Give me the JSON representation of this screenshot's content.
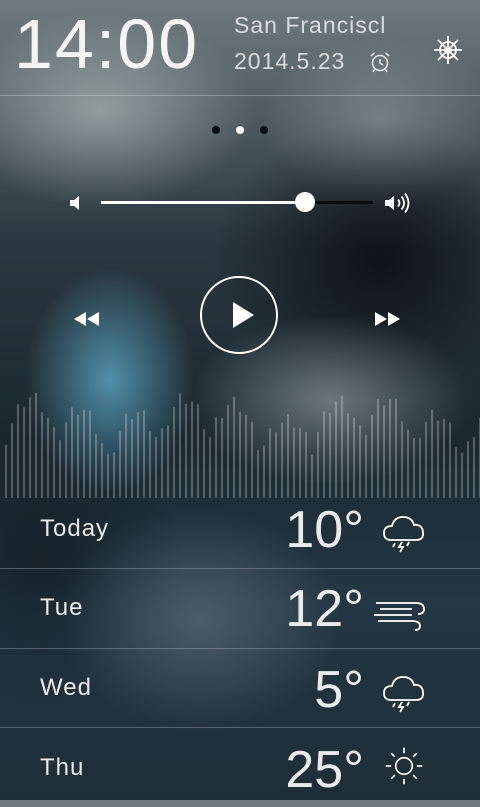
{
  "header": {
    "time": "14:00",
    "city": "San Franciscl",
    "date": "2014.5.23",
    "icons": {
      "alarm": "alarm-clock-icon",
      "settings": "ship-wheel-icon"
    }
  },
  "pager": {
    "count": 3,
    "active_index": 1
  },
  "player": {
    "volume_level": 0.75,
    "icons": {
      "volume_low": "speaker-low-icon",
      "volume_high": "speaker-high-icon",
      "rewind": "rewind-icon",
      "play": "play-icon",
      "fast_forward": "fast-forward-icon"
    }
  },
  "forecast": [
    {
      "day": "Today",
      "temp": "10°",
      "icon": "thunderstorm-cloud-icon"
    },
    {
      "day": "Tue",
      "temp": "12°",
      "icon": "wind-icon"
    },
    {
      "day": "Wed",
      "temp": "5°",
      "icon": "thunderstorm-cloud-icon"
    },
    {
      "day": "Thu",
      "temp": "25°",
      "icon": "sun-icon"
    }
  ],
  "colors": {
    "text": "#ffffff",
    "track_dark": "#0a0d10",
    "divider": "rgba(255,255,255,0.25)"
  }
}
